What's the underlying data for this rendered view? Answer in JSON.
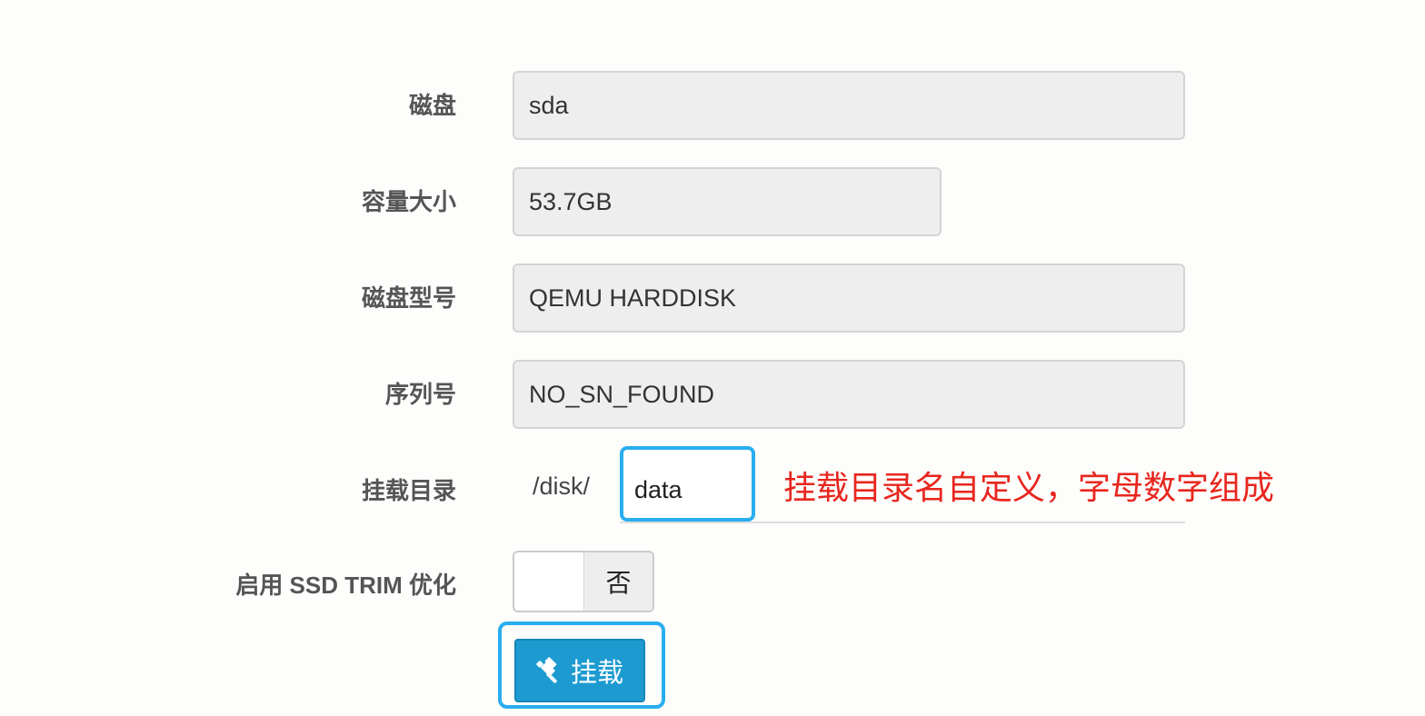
{
  "form": {
    "disk": {
      "label": "磁盘",
      "value": "sda"
    },
    "capacity": {
      "label": "容量大小",
      "value": "53.7GB"
    },
    "model": {
      "label": "磁盘型号",
      "value": "QEMU HARDDISK"
    },
    "serial": {
      "label": "序列号",
      "value": "NO_SN_FOUND"
    },
    "mount_dir": {
      "label": "挂载目录",
      "prefix": "/disk/",
      "value": "data"
    },
    "ssd_trim": {
      "label": "启用 SSD TRIM 优化",
      "state": "否"
    }
  },
  "annotation": {
    "text": "挂载目录名自定义，字母数字组成",
    "color": "#e8261e"
  },
  "mount_button": {
    "label": "挂载",
    "icon": "gavel-icon",
    "color": "#1d9bd1"
  },
  "highlight_color": "#29aef0"
}
